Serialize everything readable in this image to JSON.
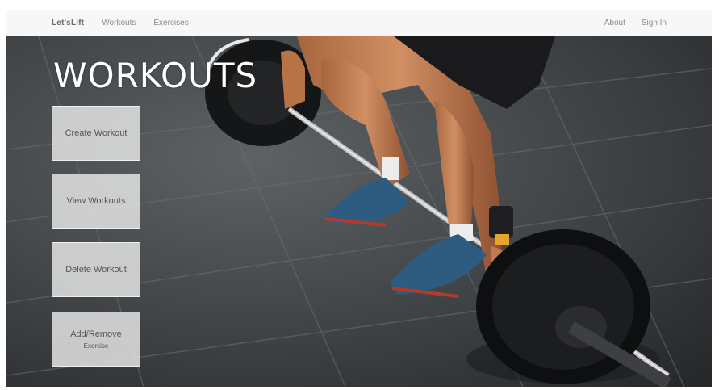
{
  "nav": {
    "brand": "Let'sLift",
    "links": [
      {
        "label": "Workouts"
      },
      {
        "label": "Exercises"
      }
    ],
    "right_links": [
      {
        "label": "About"
      },
      {
        "label": "Sign In"
      }
    ]
  },
  "hero": {
    "title": "WORKOUTS",
    "buttons": [
      {
        "label": "Create Workout",
        "sub": ""
      },
      {
        "label": "View Workouts",
        "sub": ""
      },
      {
        "label": "Delete Workout",
        "sub": ""
      },
      {
        "label": "Add/Remove",
        "sub": "Exercise"
      }
    ]
  },
  "colors": {
    "nav_bg": "#f7f7f7",
    "button_bg": "#e2e2e2",
    "title": "#ffffff",
    "floor": "#3a3d40"
  }
}
